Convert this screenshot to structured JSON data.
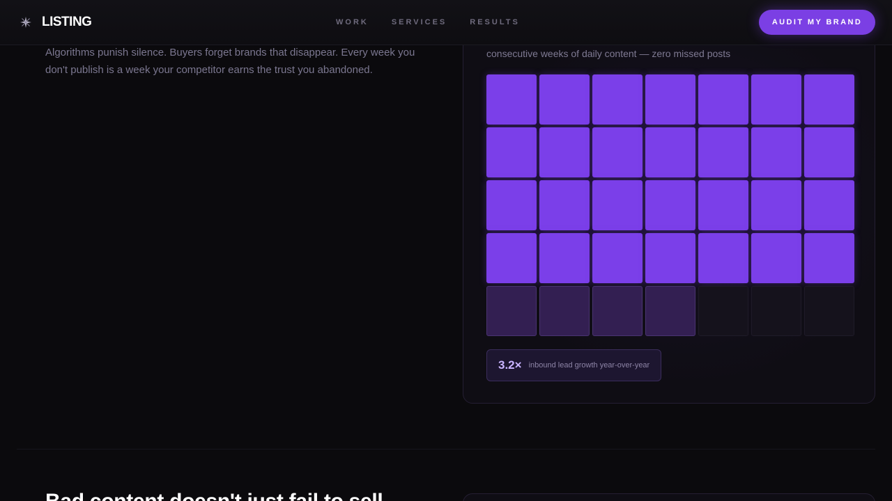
{
  "header": {
    "brand": "LISTING",
    "nav": [
      "WORK",
      "SERVICES",
      "RESULTS"
    ],
    "cta_label": "AUDIT MY BRAND"
  },
  "intro": {
    "body": "Algorithms punish silence. Buyers forget brands that disappear. Every week you don't publish is a week your competitor earns the trust you abandoned."
  },
  "streak_card": {
    "caption": "consecutive weeks of daily content — zero missed posts",
    "grid": {
      "columns": 7,
      "cells": [
        "full",
        "full",
        "full",
        "full",
        "full",
        "full",
        "full",
        "full",
        "full",
        "full",
        "full",
        "full",
        "full",
        "full",
        "full",
        "full",
        "full",
        "full",
        "full",
        "full",
        "full",
        "full",
        "full",
        "full",
        "full",
        "full",
        "full",
        "full",
        "partial",
        "partial",
        "partial",
        "partial",
        "empty",
        "empty",
        "empty"
      ]
    },
    "stat": {
      "value": "3.2×",
      "label": "inbound lead growth year-over-year"
    }
  },
  "next_section": {
    "heading": "Bad content doesn't just fail to sell."
  },
  "colors": {
    "accent": "#7b3fe4",
    "cell_full": "#7b3fe9",
    "cell_partial": "#331f52",
    "cell_empty": "#15121c",
    "background": "#0b0a0d"
  }
}
